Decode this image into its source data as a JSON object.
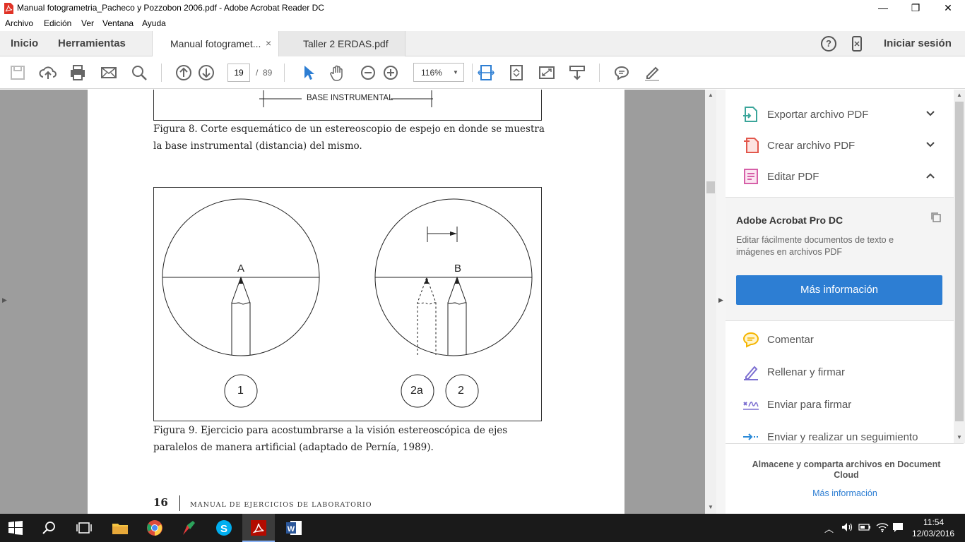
{
  "window": {
    "title": "Manual fotogrametria_Pacheco y Pozzobon 2006.pdf - Adobe Acrobat Reader DC",
    "controls": [
      "—",
      "❐",
      "✕"
    ]
  },
  "menu": [
    "Archivo",
    "Edición",
    "Ver",
    "Ventana",
    "Ayuda"
  ],
  "nav_tabs": {
    "home": "Inicio",
    "tools": "Herramientas"
  },
  "doc_tabs": [
    {
      "label": "Manual fotogramet...",
      "close": "×"
    },
    {
      "label": "Taller 2 ERDAS.pdf"
    }
  ],
  "header_right": {
    "help": "?",
    "signin": "Iniciar sesión"
  },
  "toolbar": {
    "page_current": "19",
    "page_sep": "/",
    "page_total": "89",
    "zoom": "116%"
  },
  "page": {
    "fig8_label": "BASE INSTRUMENTAL",
    "fig8_caption": "Figura 8. Corte esquemático de un estereoscopio de espejo en donde se muestra la base instrumental (distancia) del mismo.",
    "fig9": {
      "left_letter": "A",
      "right_letter": "B",
      "circle_1": "1",
      "circle_2a": "2a",
      "circle_2": "2"
    },
    "fig9_caption": "Figura 9. Ejercicio para acostumbrarse a la visión estereoscópica de ejes paralelos de manera artificial (adaptado de Pernía, 1989).",
    "page_number": "16",
    "footer_title": "MANUAL DE EJERCICIOS DE LABORATORIO"
  },
  "right_pane": {
    "tools_top": [
      {
        "label": "Exportar archivo PDF",
        "icon": "export-pdf-icon",
        "color": "#3aa59a"
      },
      {
        "label": "Crear archivo PDF",
        "icon": "create-pdf-icon",
        "color": "#e2574c"
      },
      {
        "label": "Editar PDF",
        "icon": "edit-pdf-icon",
        "color": "#d65fa8"
      }
    ],
    "promo": {
      "title": "Adobe Acrobat Pro DC",
      "desc": "Editar fácilmente documentos de texto e imágenes en archivos PDF",
      "button": "Más información"
    },
    "tools_bottom": [
      {
        "label": "Comentar",
        "icon": "comment-icon",
        "color": "#f5b400"
      },
      {
        "label": "Rellenar y firmar",
        "icon": "fill-sign-icon",
        "color": "#7c6fd1"
      },
      {
        "label": "Enviar para firmar",
        "icon": "send-sign-icon",
        "color": "#7c6fd1"
      },
      {
        "label": "Enviar y realizar un seguimiento",
        "icon": "send-track-icon",
        "color": "#2b8ad8"
      }
    ],
    "cloud_text": "Almacene y comparta archivos en Document Cloud",
    "cloud_link": "Más información"
  },
  "taskbar": {
    "time": "11:54",
    "date": "12/03/2016"
  },
  "colors": {
    "accent": "#2d7ed3",
    "promo_button": "#2d7ed3",
    "tab_bg": "#f0f0f0",
    "doc_bg": "#9d9d9d"
  }
}
